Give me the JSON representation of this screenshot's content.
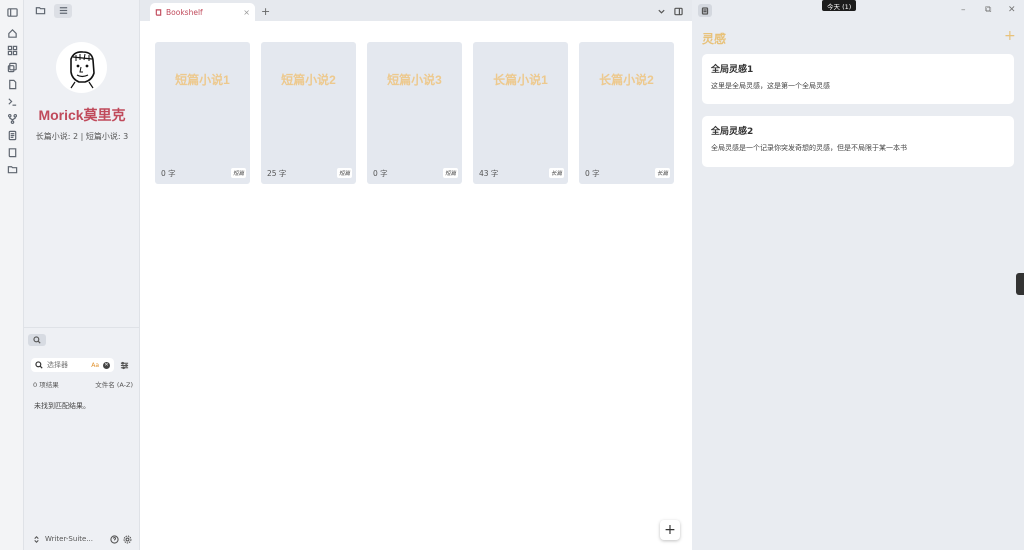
{
  "ribbon": {
    "icons": [
      "home-icon",
      "layout-grid-icon",
      "copy-icon",
      "file-icon",
      "terminal-icon",
      "git-fork-icon",
      "file-text-icon",
      "book-icon",
      "folder-open-icon"
    ]
  },
  "left_header": {
    "icons": [
      "folder-icon",
      "list-icon"
    ]
  },
  "profile": {
    "name": "Morick莫里克",
    "stats": "长篇小说: 2 | 短篇小说: 3"
  },
  "search": {
    "placeholder": "选择器",
    "case_label": "Aa",
    "result_count": "0 项结果",
    "sort_label": "文件名 (A-Z)",
    "empty_text": "未找到匹配结果。"
  },
  "footer": {
    "vault_name": "Writer-Suite..."
  },
  "tabs": [
    {
      "label": "Bookshelf",
      "close": "×"
    }
  ],
  "tab_add": "+",
  "books": [
    {
      "title": "短篇小说1",
      "count": "0 字",
      "tag": "短篇"
    },
    {
      "title": "短篇小说2",
      "count": "25 字",
      "tag": "短篇"
    },
    {
      "title": "短篇小说3",
      "count": "0 字",
      "tag": "短篇"
    },
    {
      "title": "长篇小说1",
      "count": "43 字",
      "tag": "长篇"
    },
    {
      "title": "长篇小说2",
      "count": "0 字",
      "tag": "长篇"
    }
  ],
  "fab": "+",
  "window": {
    "today_badge": "今天 (1)",
    "minimize": "–",
    "restore": "⧉",
    "close": "✕"
  },
  "inspiration": {
    "title": "灵感",
    "add": "+",
    "cards": [
      {
        "title": "全局灵感1",
        "text": "这里是全局灵感，这是第一个全局灵感"
      },
      {
        "title": "全局灵感2",
        "text": "全局灵感是一个记录你突发奇想的灵感，但是不局限于某一本书"
      }
    ]
  },
  "colors": {
    "accent_red": "#c04a5b",
    "accent_gold": "#e8c27a",
    "book_title": "#edc98e"
  }
}
